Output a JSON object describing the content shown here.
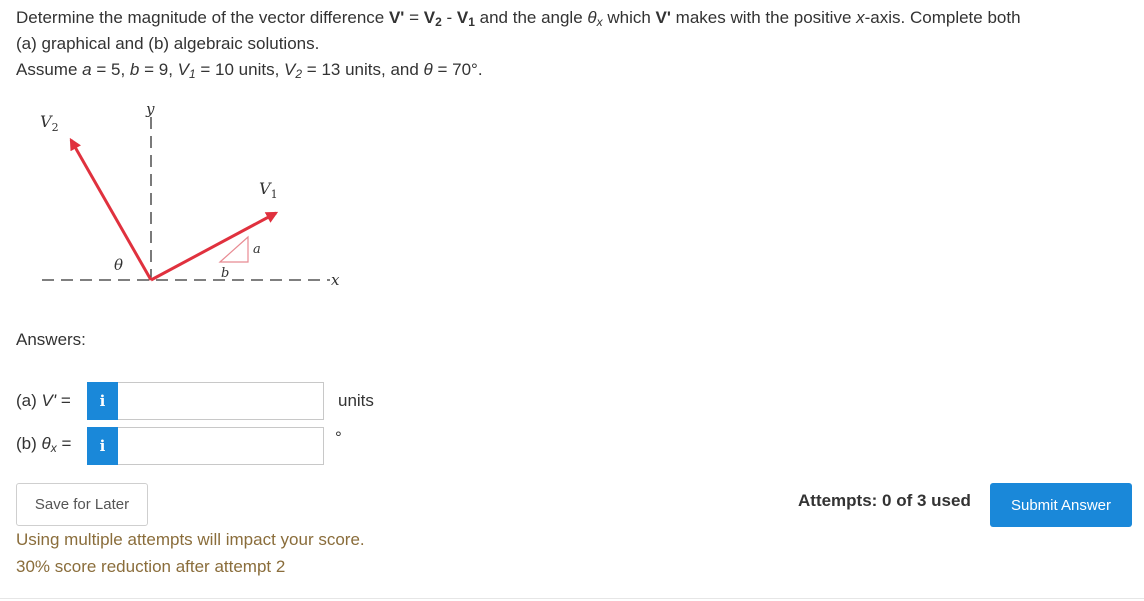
{
  "problem": {
    "line1_a": "Determine the magnitude of the vector difference ",
    "line1_vp": "V'",
    "line1_eq": " = ",
    "line1_v2": "V",
    "line1_v2_sub": "2",
    "line1_minus": " - ",
    "line1_v1": "V",
    "line1_v1_sub": "1",
    "line1_b": " and the angle ",
    "line1_theta": "θ",
    "line1_theta_sub": "x",
    "line1_c": " which ",
    "line1_vp2": "V'",
    "line1_d": " makes with the positive ",
    "line1_x": "x",
    "line1_e": "-axis. Complete both",
    "line2": "(a) graphical and (b) algebraic solutions.",
    "line3_a": "Assume ",
    "line3_av": "a",
    "line3_b": " = 5, ",
    "line3_bv": "b",
    "line3_c": " = 9, ",
    "line3_v1": "V",
    "line3_v1_sub": "1",
    "line3_d": " = 10 units, ",
    "line3_v2": "V",
    "line3_v2_sub": "2",
    "line3_e": " = 13 units, and ",
    "line3_theta": "θ",
    "line3_f": " = 70°."
  },
  "figure": {
    "y_label": "y",
    "x_label": "x",
    "v2_label": "V",
    "v2_sub": "2",
    "v1_label": "V",
    "v1_sub": "1",
    "theta_label": "θ",
    "a_label": "a",
    "b_label": "b",
    "arrow_color": "#e0313e",
    "triangle_color": "#e88a92"
  },
  "answers": {
    "heading": "Answers:",
    "a_label_pre": "(a) ",
    "a_label_var": "V'",
    "a_label_post": " =",
    "a_info": "i",
    "a_value": "",
    "a_unit": "units",
    "b_label_pre": "(b) ",
    "b_label_var": "θ",
    "b_label_sub": "x",
    "b_label_post": " =",
    "b_info": "i",
    "b_value": "",
    "b_unit": "°"
  },
  "actions": {
    "save_label": "Save for Later",
    "attempts_text": "Attempts: 0 of 3 used",
    "submit_label": "Submit Answer",
    "warning1": "Using multiple attempts will impact your score.",
    "warning2": "30% score reduction after attempt 2"
  },
  "colors": {
    "accent": "#1a88d9",
    "warning_text": "#8a6d3b"
  }
}
